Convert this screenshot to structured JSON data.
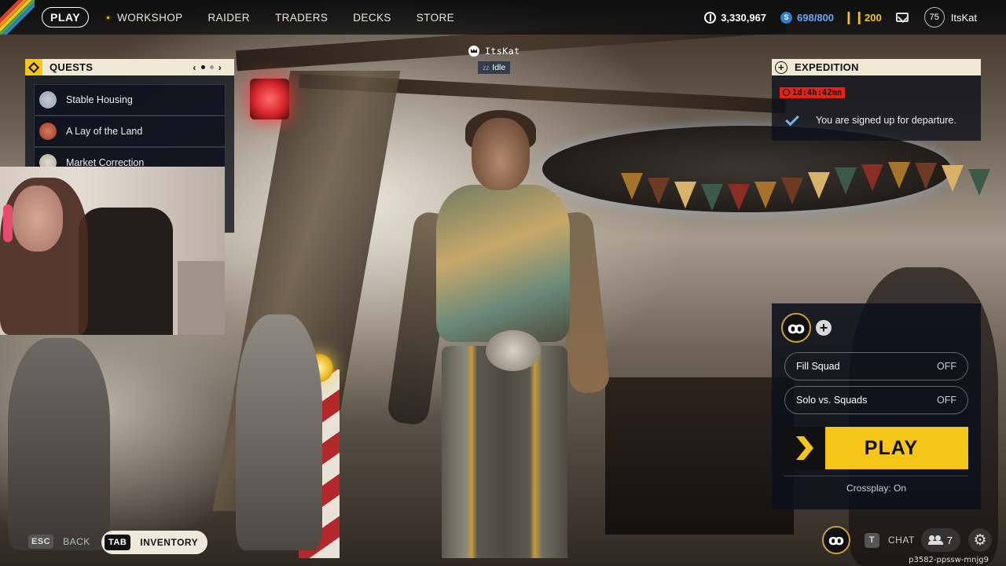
{
  "nav": {
    "items": [
      {
        "label": "PLAY",
        "active": true
      },
      {
        "label": "WORKSHOP",
        "has_dot": true
      },
      {
        "label": "RAIDER"
      },
      {
        "label": "TRADERS"
      },
      {
        "label": "DECKS"
      },
      {
        "label": "STORE"
      }
    ]
  },
  "currencies": {
    "coins": "3,330,967",
    "seeds": "698/800",
    "credits": "200"
  },
  "profile": {
    "level": "75",
    "username": "ItsKat"
  },
  "quests": {
    "title": "QUESTS",
    "pager_prev": "‹",
    "pager_next": "›",
    "items": [
      {
        "label": "Stable Housing",
        "portrait_color": "#8fa0b0"
      },
      {
        "label": "A Lay of the Land",
        "portrait_color": "#9b3a2a"
      },
      {
        "label": "Market Correction",
        "portrait_color": "#b0a89a"
      }
    ]
  },
  "player_tag": {
    "name": "ItsKat",
    "status": "Idle",
    "status_icon": "zz"
  },
  "expedition": {
    "title": "EXPEDITION",
    "timer": "1d:4h:42mn",
    "message": "You are signed up for departure."
  },
  "squad": {
    "emblem_glyph": "ꝏ",
    "add_glyph": "+",
    "fill_squad": {
      "label": "Fill Squad",
      "value": "OFF"
    },
    "solo_vs_squads": {
      "label": "Solo vs. Squads",
      "value": "OFF"
    },
    "play_label": "PLAY",
    "crossplay": "Crossplay: On"
  },
  "bottom": {
    "back_key": "ESC",
    "back_label": "BACK",
    "inventory_key": "TAB",
    "inventory_label": "INVENTORY",
    "chat_key": "T",
    "chat_label": "CHAT",
    "friends_count": "7",
    "gear_glyph": "⚙",
    "session_id": "p3582-ppssw-mnjg9"
  },
  "colors": {
    "accent": "#f5c518",
    "panel_header": "#f0e9d6",
    "timer": "#e2231a",
    "check": "#6fb4ea",
    "seed_text": "#69a8ee"
  },
  "icons": [
    "crown-icon",
    "check-icon",
    "clock-icon",
    "people-icon",
    "gear-icon",
    "mail-icon",
    "plus-circle-icon",
    "diamond-icon"
  ]
}
